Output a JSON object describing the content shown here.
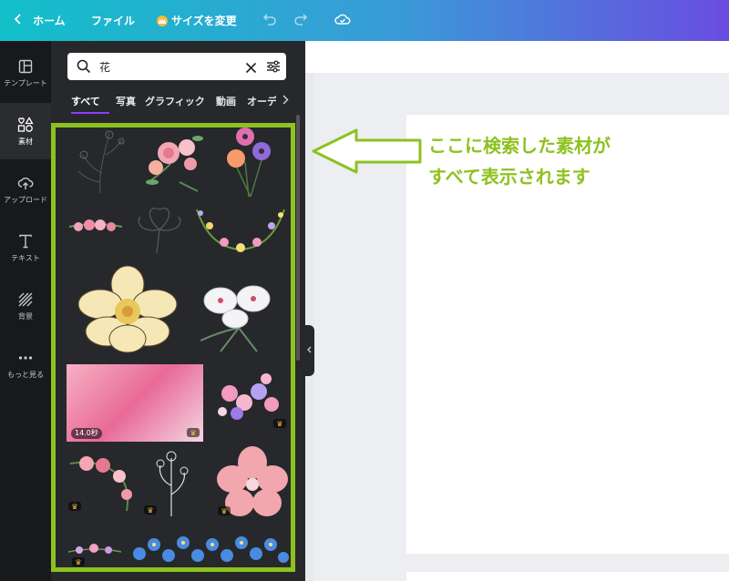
{
  "topbar": {
    "home_label": "ホーム",
    "file_label": "ファイル",
    "resize_label": "サイズを変更"
  },
  "rail": {
    "items": [
      {
        "label": "テンプレート"
      },
      {
        "label": "素材"
      },
      {
        "label": "アップロード"
      },
      {
        "label": "テキスト"
      },
      {
        "label": "背景"
      },
      {
        "label": "もっと見る"
      }
    ]
  },
  "search": {
    "value": "花"
  },
  "tabs": [
    "すべて",
    "写真",
    "グラフィック",
    "動画",
    "オーデ"
  ],
  "results": {
    "video_duration": "14.0秒"
  },
  "annotation": {
    "line1": "ここに検索した素材が",
    "line2": "すべて表示されます"
  },
  "colors": {
    "highlight": "#8dc21f",
    "accent": "#8b3dff"
  }
}
